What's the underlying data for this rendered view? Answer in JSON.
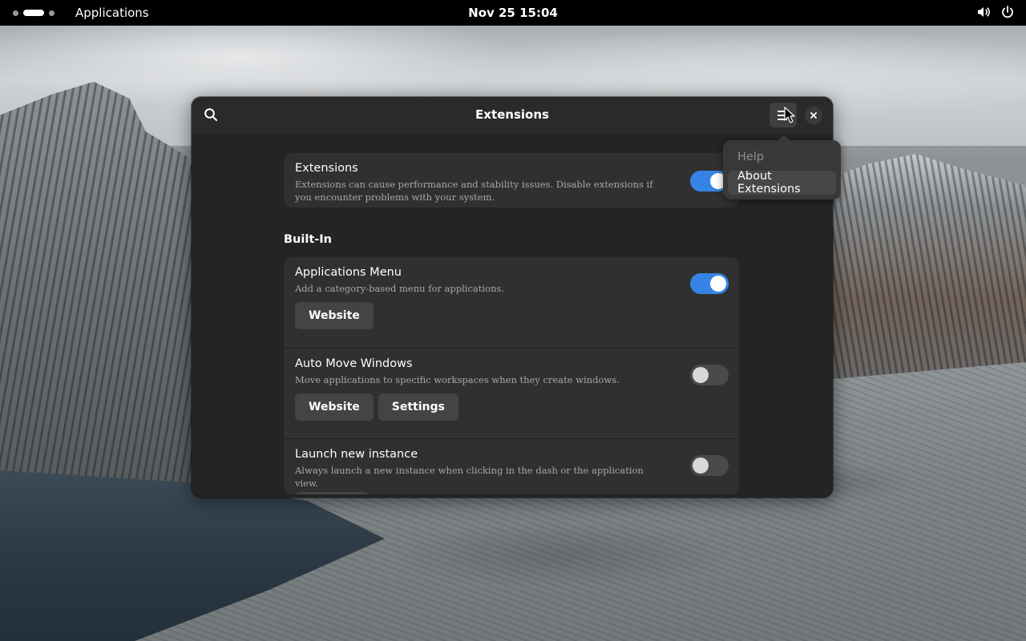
{
  "topbar": {
    "apps_label": "Applications",
    "clock": "Nov 25  15:04",
    "icons": [
      "volume-icon",
      "power-icon"
    ]
  },
  "window": {
    "title": "Extensions",
    "header_icons": [
      "search-icon",
      "menu-icon",
      "close-icon"
    ],
    "main_switch": {
      "title": "Extensions",
      "description": "Extensions can cause performance and stability issues. Disable extensions if you encounter problems with your system.",
      "enabled": true
    },
    "section_label": "Built-In",
    "extensions": [
      {
        "title": "Applications Menu",
        "description": "Add a category-based menu for applications.",
        "enabled": true,
        "buttons": [
          "Website"
        ]
      },
      {
        "title": "Auto Move Windows",
        "description": "Move applications to specific workspaces when they create windows.",
        "enabled": false,
        "buttons": [
          "Website",
          "Settings"
        ]
      },
      {
        "title": "Launch new instance",
        "description": "Always launch a new instance when clicking in the dash or the application view.",
        "enabled": false,
        "buttons": []
      }
    ]
  },
  "menu_popover": {
    "items": [
      {
        "label": "Help",
        "muted": true
      },
      {
        "label": "About Extensions",
        "muted": false,
        "hover": true
      }
    ]
  },
  "colors": {
    "accent": "#3584e4",
    "window_bg": "#242424",
    "card_bg": "#303030",
    "topbar_bg": "#000000"
  }
}
